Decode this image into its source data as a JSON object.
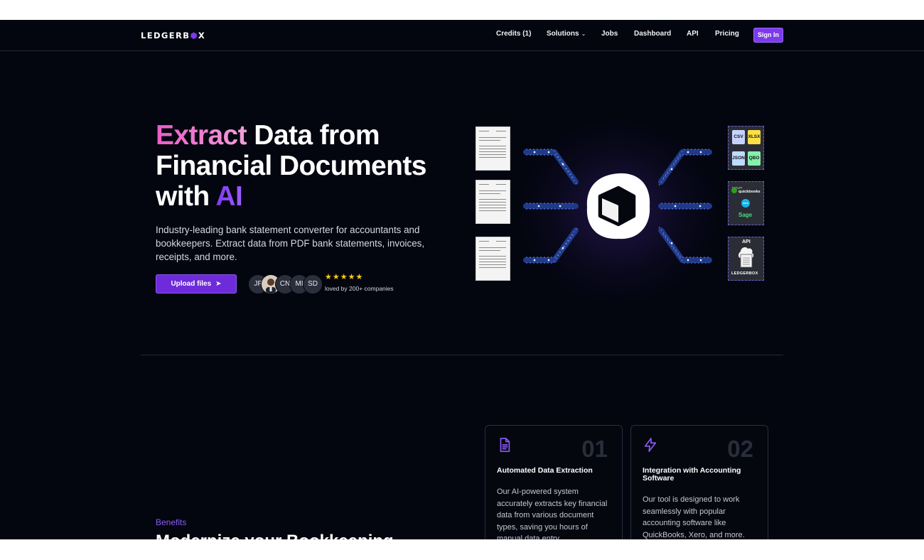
{
  "nav": {
    "logo_text": "LEDGERB",
    "logo_cube": "⬢",
    "logo_tail": "X",
    "links": [
      {
        "label": "Credits (1)"
      },
      {
        "label": "Solutions",
        "has_dropdown": true
      },
      {
        "label": "Jobs"
      },
      {
        "label": "Dashboard"
      },
      {
        "label": "API"
      },
      {
        "label": "Pricing"
      }
    ],
    "signin_label": "Sign In"
  },
  "hero": {
    "title_word1": "Extract",
    "title_rest1": "Data from",
    "title_line2": "Financial Documents",
    "title_with": "with",
    "title_ai": "AI",
    "subtitle": "Industry-leading bank statement converter for accountants and bookkeepers. Extract data from PDF bank statements, invoices, receipts, and more.",
    "upload_label": "Upload files",
    "avatars": [
      "JF",
      "",
      "CN",
      "MI",
      "SD"
    ],
    "stars": "★★★★★",
    "loved_text": "loved by 200+ companies"
  },
  "illustration": {
    "formats": [
      "CSV",
      "XLSX",
      "JSON",
      "QBO"
    ],
    "integrations": [
      "quickbooks",
      "xero",
      "Sage"
    ],
    "intuit_label": "INTUIT",
    "api_label": "API",
    "api_brand": "LEDGERBOX"
  },
  "colors": {
    "accent": "#7c3aed",
    "background": "#03050f",
    "pink": "#ec5cc7"
  },
  "features": [
    {
      "number": "01",
      "title": "Automated Data Extraction",
      "desc": "Our AI-powered system accurately extracts key financial data from various document types, saving you hours of manual data entry.",
      "icon": "document-icon"
    },
    {
      "number": "02",
      "title": "Integration with Accounting Software",
      "desc": "Our tool is designed to work seamlessly with popular accounting software like QuickBooks, Xero, and more.",
      "icon": "lightning-icon"
    }
  ],
  "benefits": {
    "eyebrow": "Benefits",
    "heading": "Modernize your Bookkeeping"
  }
}
